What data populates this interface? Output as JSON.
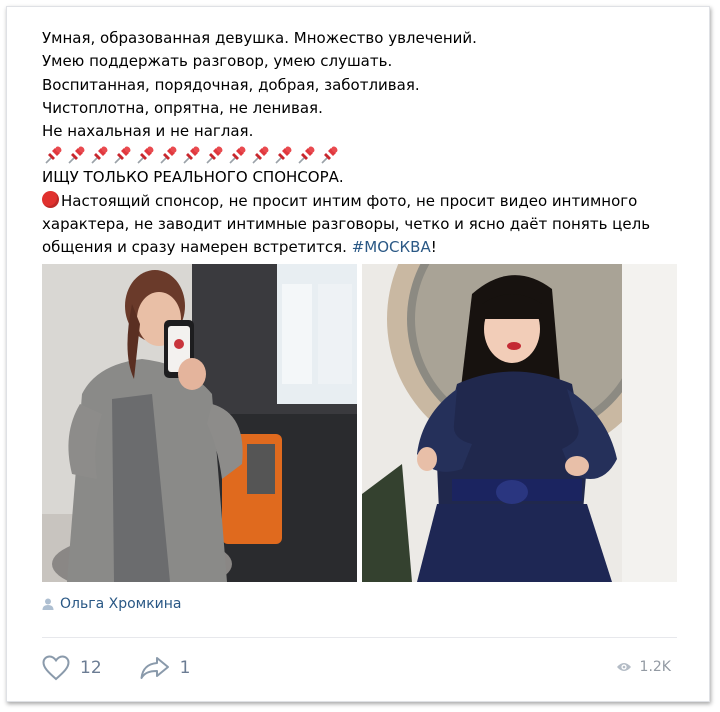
{
  "post": {
    "lines": [
      "Умная, образованная девушка. Множество увлечений.",
      "Умею поддержать разговор, умею слушать.",
      "Воспитанная, порядочная, добрая, заботливая.",
      "Чистоплотна, опрятна, не ленивая.",
      "Не нахальная и не наглая."
    ],
    "pin_icon": "pushpin-emoji",
    "pin_count": 13,
    "headline": "ИЩУ ТОЛЬКО РЕАЛЬНОГО СПОНСОРА.",
    "sponsor_line1": "Настоящий спонсор, не просит интим фото, не просит видео интимного",
    "sponsor_line2": "характера, не заводит интимные разговоры, четко и ясно даёт понять цель",
    "sponsor_line3_text": "общения и сразу намерен встретится. ",
    "hashtag": "#МОСКВА",
    "hashtag_suffix": "!",
    "stop_icon": "red-circle-emoji"
  },
  "author": {
    "icon": "user-icon",
    "name": "Ольга Хромкина"
  },
  "stats": {
    "like_icon": "heart-icon",
    "likes": "12",
    "share_icon": "share-arrow-icon",
    "shares": "1",
    "views_icon": "eye-icon",
    "views": "1.2K"
  },
  "colors": {
    "link": "#2a5885",
    "muted": "#6b7c93",
    "stop": "#e0312e"
  }
}
